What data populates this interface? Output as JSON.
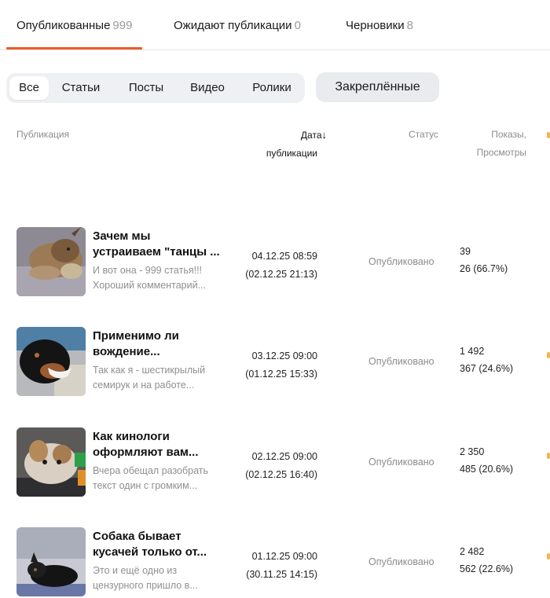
{
  "tabs": [
    {
      "label": "Опубликованные",
      "count": "999"
    },
    {
      "label": "Ожидают публикации",
      "count": "0"
    },
    {
      "label": "Черновики",
      "count": "8"
    }
  ],
  "filters": [
    "Все",
    "Статьи",
    "Посты",
    "Видео",
    "Ролики"
  ],
  "pinned_label": "Закреплённые",
  "columns": {
    "publication": "Публикация",
    "date_line1": "Дата",
    "date_line2": "публикации",
    "sort_arrow": "↓",
    "status": "Статус",
    "views_line1": "Показы,",
    "views_line2": "Просмотры"
  },
  "colors": {
    "accent": "#ef5a2a",
    "edge_marker": "#f2b64a"
  },
  "rows": [
    {
      "title1": "Зачем мы",
      "title2": "устраиваем \"танцы ...",
      "desc1": "И вот она - 999 статья!!!",
      "desc2": "Хороший комментарий...",
      "date": "04.12.25 08:59",
      "date_orig": "(02.12.25 21:13)",
      "status": "Опубликовано",
      "impressions": "39",
      "views": "26 (66.7%)"
    },
    {
      "title1": "Применимо ли",
      "title2": "вождение...",
      "desc1": "Так как я - шестикрылый",
      "desc2": "семирук и на работе...",
      "date": "03.12.25 09:00",
      "date_orig": "(01.12.25 15:33)",
      "status": "Опубликовано",
      "impressions": "1 492",
      "views": "367 (24.6%)"
    },
    {
      "title1": "Как кинологи",
      "title2": "оформляют вам...",
      "desc1": "Вчера обещал разобрать",
      "desc2": "текст один с громким...",
      "date": "02.12.25 09:00",
      "date_orig": "(02.12.25 16:40)",
      "status": "Опубликовано",
      "impressions": "2 350",
      "views": "485 (20.6%)"
    },
    {
      "title1": "Собака бывает",
      "title2": "кусачей только от...",
      "desc1": "Это и ещё одно из",
      "desc2": "цензурного пришло в...",
      "date": "01.12.25 09:00",
      "date_orig": "(30.11.25 14:15)",
      "status": "Опубликовано",
      "impressions": "2 482",
      "views": "562 (22.6%)"
    }
  ]
}
